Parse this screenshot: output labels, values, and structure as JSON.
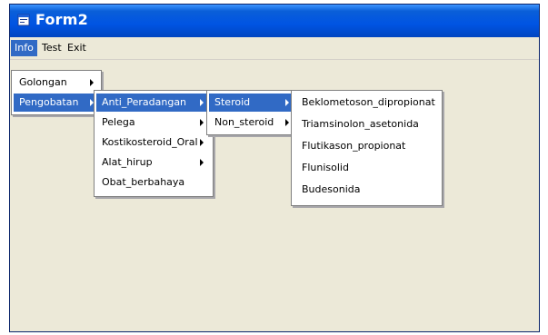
{
  "window": {
    "title": "Form2"
  },
  "menubar": {
    "items": [
      {
        "label": "Info",
        "active": true
      },
      {
        "label": "Test",
        "active": false
      },
      {
        "label": "Exit",
        "active": false
      }
    ]
  },
  "info_menu": {
    "items": [
      {
        "label": "Golongan"
      },
      {
        "label": "Pengobatan"
      }
    ]
  },
  "pengobatan_menu": {
    "items": [
      {
        "label": "Anti_Peradangan"
      },
      {
        "label": "Pelega"
      },
      {
        "label": "Kostikosteroid_Oral"
      },
      {
        "label": "Alat_hirup"
      },
      {
        "label": "Obat_berbahaya"
      }
    ]
  },
  "anti_peradangan_menu": {
    "items": [
      {
        "label": "Steroid"
      },
      {
        "label": "Non_steroid"
      }
    ]
  },
  "steroid_menu": {
    "items": [
      {
        "label": "Beklometoson_dipropionat"
      },
      {
        "label": "Triamsinolon_asetonida"
      },
      {
        "label": "Flutikason_propionat"
      },
      {
        "label": "Flunisolid"
      },
      {
        "label": "Budesonida"
      }
    ]
  },
  "colors": {
    "titlebar": "#0054e3",
    "highlight": "#316ac5",
    "window_bg": "#ece9d8",
    "menu_bg": "#ffffff"
  }
}
